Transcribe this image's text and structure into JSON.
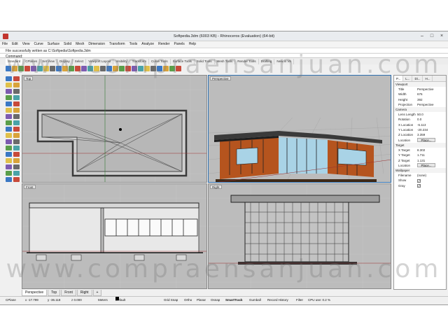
{
  "window": {
    "title": "Softpedia.3dm (6003 KB) - Rhinoceros (Evaluation) (64-bit)",
    "controls": [
      "–",
      "□",
      "×"
    ]
  },
  "menu": [
    "File",
    "Edit",
    "View",
    "Curve",
    "Surface",
    "Solid",
    "Mesh",
    "Dimension",
    "Transform",
    "Tools",
    "Analyze",
    "Render",
    "Panels",
    "Help"
  ],
  "history": "File successfully written as C:\\Softpedia\\Softpedia.3dm",
  "command": {
    "label": "Command:"
  },
  "toolbar_tabs": [
    "Standard",
    "CPlanes",
    "Set View",
    "Display",
    "Select",
    "Viewport Layout",
    "Visibility",
    "Transform",
    "Curve Tools",
    "Surface Tools",
    "Solid Tools",
    "Mesh Tools",
    "Render Tools",
    "Drafting",
    "New in V5"
  ],
  "viewports": {
    "top": "Top",
    "perspective": "Perspective",
    "front": "Front",
    "right": "Right"
  },
  "viewport_tabs": [
    "Perspective",
    "Top",
    "Front",
    "Right",
    "+"
  ],
  "panel": {
    "tabs": [
      "P...",
      "L...",
      "Di...",
      "H..."
    ],
    "viewport_section": "Viewport",
    "viewport_props": [
      {
        "name": "Title",
        "value": "Perspective"
      },
      {
        "name": "Width",
        "value": "676"
      },
      {
        "name": "Height",
        "value": "392"
      },
      {
        "name": "Projection",
        "value": "Perspective"
      }
    ],
    "camera_section": "Camera",
    "camera_props": [
      {
        "name": "Lens Length",
        "value": "50.0"
      },
      {
        "name": "Rotation",
        "value": "0.0"
      },
      {
        "name": "X Location",
        "value": "-6.113"
      },
      {
        "name": "Y Location",
        "value": "-20.234"
      },
      {
        "name": "Z Location",
        "value": "3.359"
      }
    ],
    "camera_location": {
      "name": "Location",
      "button": "Place..."
    },
    "target_section": "Target",
    "target_props": [
      {
        "name": "X Target",
        "value": "8.302"
      },
      {
        "name": "Y Target",
        "value": "1.711"
      },
      {
        "name": "Z Target",
        "value": "1.131"
      }
    ],
    "target_location": {
      "name": "Location",
      "button": "Place..."
    },
    "wallpaper_section": "Wallpaper",
    "wallpaper": [
      {
        "name": "Filename",
        "value": "(none)"
      },
      {
        "name": "Show",
        "value": "✓"
      },
      {
        "name": "Gray",
        "value": "✓"
      }
    ]
  },
  "status": {
    "cplane": "CPlane",
    "x": "x -17.799",
    "y": "y -36.118",
    "z": "z 0.000",
    "units": "Meters",
    "layer": "Default",
    "toggles": [
      "Grid Snap",
      "Ortho",
      "Planar",
      "Osnap",
      "SmartTrack",
      "Gumball",
      "Record History",
      "Filter"
    ],
    "cpu": "CPU use: 0.2 %"
  },
  "watermark": "www.compraensanjuan.com",
  "colors": {
    "viewport_bg": "#bcbcbc",
    "active_border": "#2d6fb0",
    "wall_orange": "#b5541e",
    "roof_dark": "#3a3a3a",
    "glass": "#a9d3e6"
  },
  "icons": {
    "toolbar": [
      "new-file",
      "open",
      "save",
      "print",
      "import",
      "cut",
      "copy",
      "paste",
      "undo",
      "redo",
      "pan",
      "rotate-view",
      "zoom",
      "zoom-window",
      "zoom-extents",
      "zoom-selected",
      "set-view",
      "four-viewports",
      "cplane",
      "layers",
      "properties",
      "render",
      "materials",
      "lights",
      "osnap",
      "grid",
      "options",
      "help"
    ],
    "left": [
      "select",
      "point",
      "line",
      "polyline",
      "curve",
      "arc",
      "circle",
      "ellipse",
      "rectangle",
      "polygon",
      "fillet",
      "offset",
      "surface",
      "extrude",
      "sphere",
      "box",
      "cylinder",
      "boolean",
      "mesh",
      "dimension",
      "text",
      "move",
      "copy",
      "rotate",
      "scale",
      "mirror",
      "array",
      "split",
      "trim",
      "join",
      "explode",
      "group",
      "analyze",
      "render"
    ]
  }
}
